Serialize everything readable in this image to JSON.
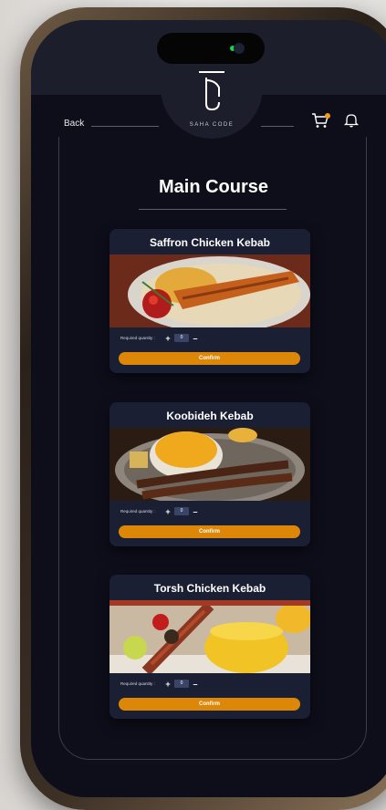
{
  "header": {
    "logo_text": "SAHA CODE",
    "back_label": "Back",
    "cart_icon": "cart-icon",
    "bell_icon": "bell-icon",
    "accent_color": "#dd8708"
  },
  "page": {
    "title": "Main Course"
  },
  "items": [
    {
      "name": "Saffron Chicken Kebab",
      "quantity_label": "Required quantity :",
      "quantity": "0",
      "confirm_label": "Confirm"
    },
    {
      "name": "Koobideh Kebab",
      "quantity_label": "Required quantity :",
      "quantity": "0",
      "confirm_label": "Confirm"
    },
    {
      "name": "Torsh Chicken Kebab",
      "quantity_label": "Required quantity :",
      "quantity": "0",
      "confirm_label": "Confirm"
    }
  ]
}
